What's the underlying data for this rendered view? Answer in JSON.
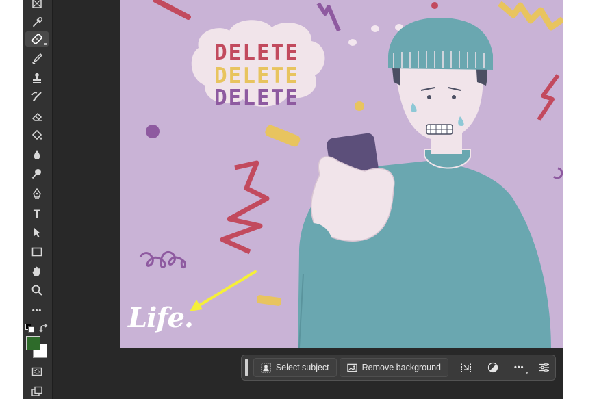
{
  "toolbar": {
    "tools": [
      "artboard",
      "eyedropper",
      "spot-healing-brush",
      "brush",
      "clone-stamp",
      "history-brush",
      "eraser",
      "paint-bucket",
      "blur",
      "dodge",
      "pen",
      "type",
      "path-selection",
      "rectangle",
      "hand",
      "zoom",
      "more"
    ],
    "active_tool": "spot-healing-brush",
    "type_glyph": "T",
    "more_glyph": "•••",
    "foreground_color": "#2e6b2a",
    "background_color": "#ffffff"
  },
  "canvas": {
    "bubble_lines": [
      "DELETE",
      "DELETE",
      "DELETE"
    ],
    "bubble_colors": [
      "#c24a5e",
      "#e8c45f",
      "#8e5aa0"
    ],
    "logo_text": "Life.",
    "background_color": "#c9b3d6",
    "arrow_color": "#f5ef3a"
  },
  "contextual_taskbar": {
    "select_subject_label": "Select subject",
    "remove_background_label": "Remove background",
    "more_glyph": "•••"
  }
}
